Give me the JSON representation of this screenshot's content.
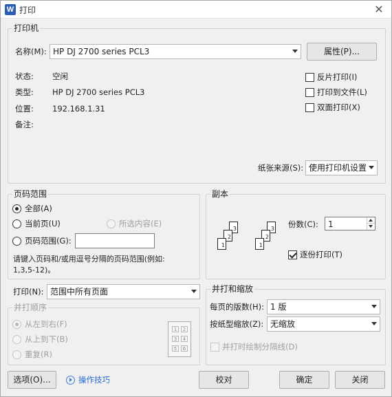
{
  "window": {
    "title": "打印",
    "app_icon": "W",
    "close": "✕"
  },
  "printer": {
    "group_title": "打印机",
    "name_label": "名称(M):",
    "name_value": "HP DJ 2700 series PCL3",
    "properties_button": "属性(P)...",
    "status_label": "状态:",
    "status_value": "空闲",
    "type_label": "类型:",
    "type_value": "HP DJ 2700 series PCL3",
    "location_label": "位置:",
    "location_value": "192.168.1.31",
    "comment_label": "备注:",
    "reverse_print": "反片打印(I)",
    "print_to_file": "打印到文件(L)",
    "duplex": "双面打印(X)",
    "paper_source_label": "纸张来源(S):",
    "paper_source_value": "使用打印机设置"
  },
  "page_range": {
    "group_title": "页码范围",
    "all": "全部(A)",
    "current": "当前页(U)",
    "selection": "所选内容(E)",
    "range": "页码范围(G):",
    "range_value": "",
    "hint_line1": "请键入页码和/或用逗号分隔的页码范围(例如:",
    "hint_line2": "1,3,5-12)。"
  },
  "print_what": {
    "label": "打印(N):",
    "value": "范围中所有页面"
  },
  "collate_order": {
    "group_title": "并打顺序",
    "left_to_right": "从左到右(F)",
    "top_to_bottom": "从上到下(B)",
    "repeat": "重复(R)",
    "preview_cells": [
      "1",
      "2",
      "3",
      "4",
      "5",
      "6"
    ]
  },
  "copies": {
    "group_title": "副本",
    "count_label": "份数(C):",
    "count_value": "1",
    "collate": "逐份打印(T)",
    "page_numbers": [
      "3",
      "2",
      "1",
      "3",
      "2",
      "1"
    ]
  },
  "zoom": {
    "group_title": "并打和缩放",
    "pages_per_sheet_label": "每页的版数(H):",
    "pages_per_sheet_value": "1 版",
    "scale_label": "按纸型缩放(Z):",
    "scale_value": "无缩放",
    "draw_borders": "并打时绘制分隔线(D)"
  },
  "footer": {
    "options_button": "选项(O)...",
    "tips_link": "操作技巧",
    "proof_button": "校对",
    "ok_button": "确定",
    "close_button": "关闭"
  }
}
